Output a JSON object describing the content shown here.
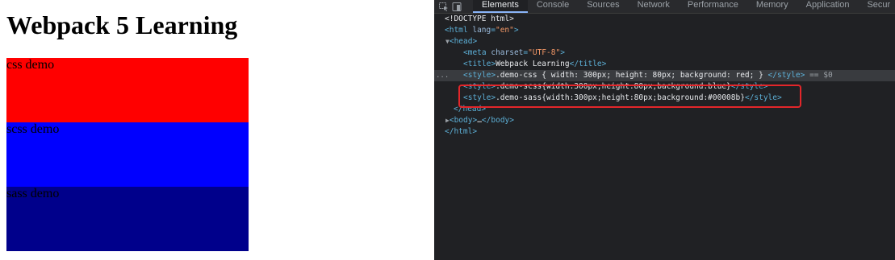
{
  "page": {
    "heading": "Webpack 5 Learning",
    "demos": [
      {
        "label": "css demo",
        "color": "#ff0000"
      },
      {
        "label": "scss demo",
        "color": "#0000ff"
      },
      {
        "label": "sass demo",
        "color": "#00008b"
      }
    ]
  },
  "devtools": {
    "tabs": [
      "Elements",
      "Console",
      "Sources",
      "Network",
      "Performance",
      "Memory",
      "Application",
      "Secur"
    ],
    "active_tab": "Elements",
    "icons": [
      "element-picker-icon",
      "device-toggle-icon"
    ],
    "selected_node_marker": "== $0",
    "row_ellipsis": "...",
    "dom": {
      "doctype": "<!DOCTYPE html>",
      "html_open_tag": "html",
      "lang_attr": "lang",
      "lang_value": "\"en\"",
      "head_tag": "head",
      "meta_tag": "meta",
      "charset_attr": "charset",
      "charset_value": "\"UTF-8\"",
      "title_tag": "title",
      "title_text": "Webpack Learning",
      "style_tag": "style",
      "style_css": ".demo-css { width: 300px; height: 80px; background: red; } ",
      "style_scss": ".demo-scss{width:300px;height:80px;background:blue}",
      "style_sass": ".demo-sass{width:300px;height:80px;background:#00008b}",
      "body_tag": "body",
      "body_ellipsis": "…"
    }
  },
  "colors": {
    "highlight_border": "#e3262a",
    "devtools_bg": "#202124",
    "active_tab_underline": "#8ab4f8"
  }
}
